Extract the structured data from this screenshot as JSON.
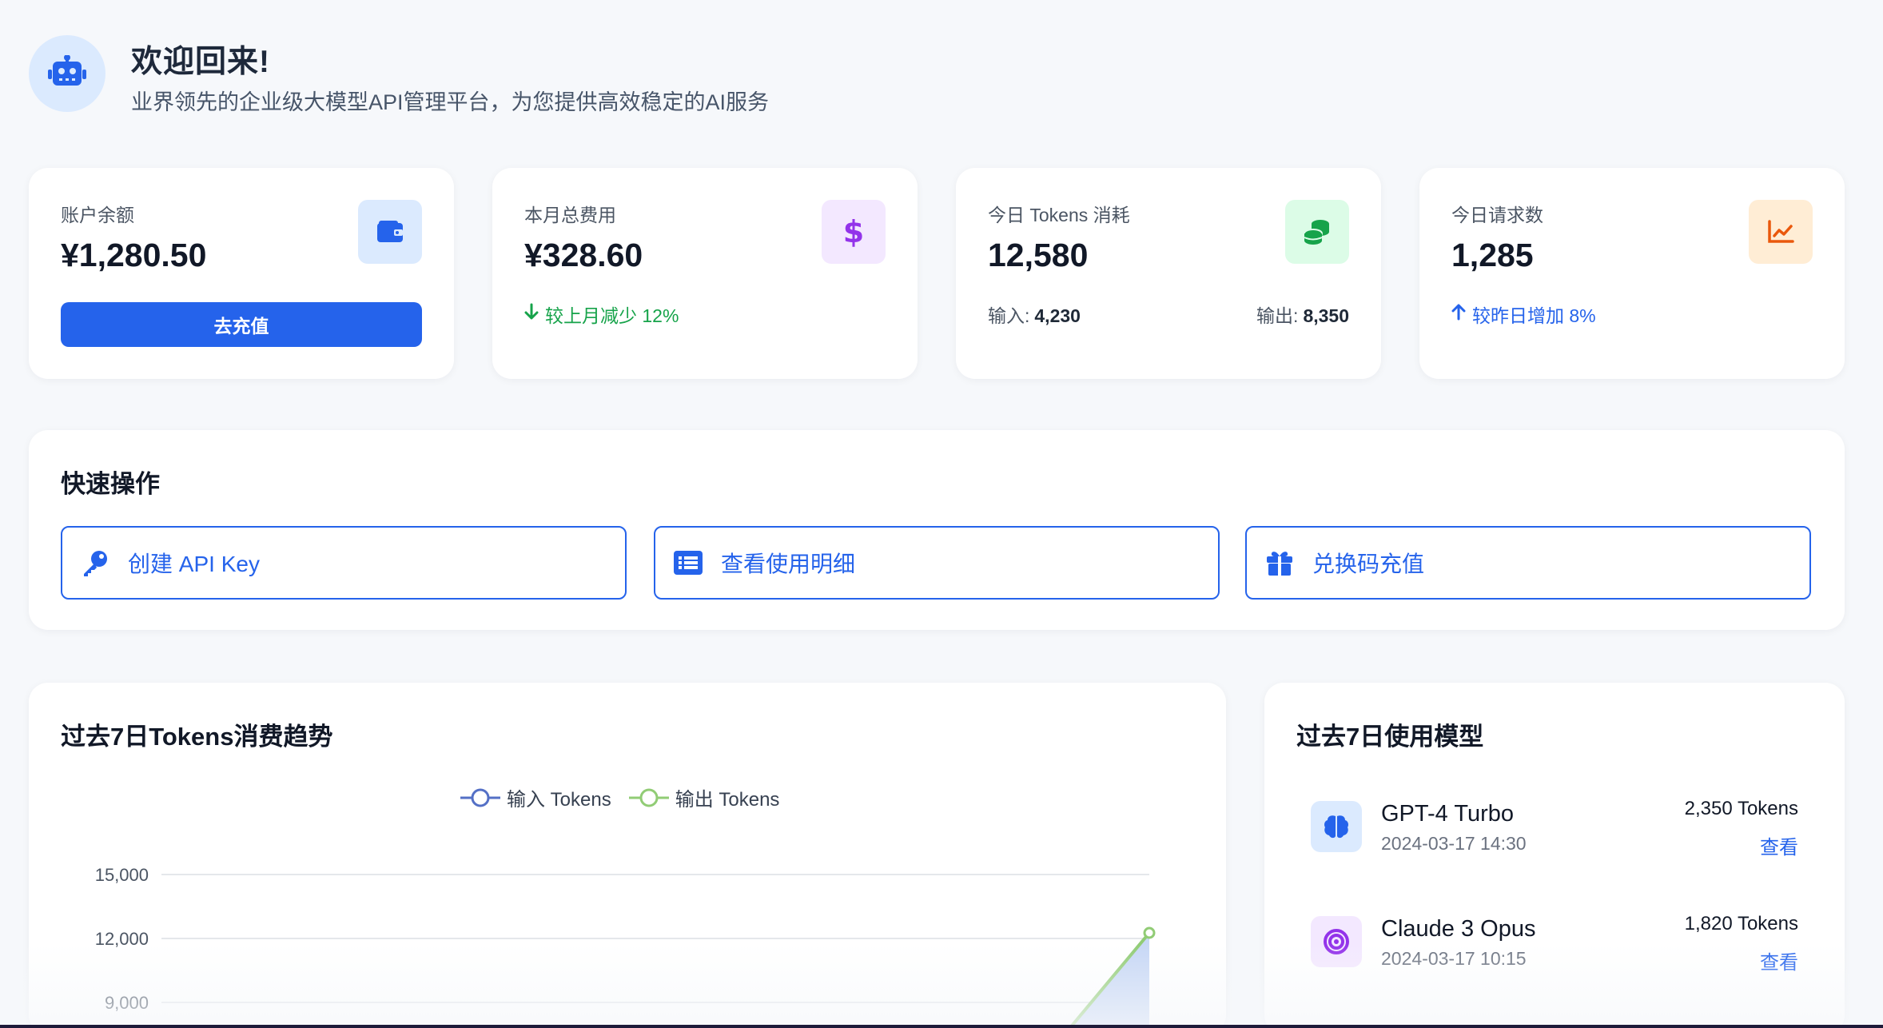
{
  "header": {
    "title": "欢迎回来!",
    "subtitle": "业界领先的企业级大模型API管理平台，为您提供高效稳定的AI服务",
    "avatar_icon": "robot-icon"
  },
  "stats": {
    "balance": {
      "label": "账户余额",
      "value": "¥1,280.50",
      "button": "去充值",
      "icon": "wallet-icon",
      "color": "#2563eb"
    },
    "monthly_cost": {
      "label": "本月总费用",
      "value": "¥328.60",
      "trend": "较上月减少 12%",
      "trend_dir": "down",
      "icon": "dollar-icon",
      "color": "#9333ea"
    },
    "tokens_today": {
      "label": "今日 Tokens 消耗",
      "value": "12,580",
      "input_label": "输入:",
      "input_value": "4,230",
      "output_label": "输出:",
      "output_value": "8,350",
      "icon": "coins-icon",
      "color": "#16a34a"
    },
    "requests_today": {
      "label": "今日请求数",
      "value": "1,285",
      "trend": "较昨日增加 8%",
      "trend_dir": "up",
      "icon": "chart-line-icon",
      "color": "#ea580c"
    }
  },
  "quick_actions": {
    "title": "快速操作",
    "items": [
      {
        "label": "创建 API Key",
        "icon": "key-icon"
      },
      {
        "label": "查看使用明细",
        "icon": "list-icon"
      },
      {
        "label": "兑换码充值",
        "icon": "gift-icon"
      }
    ]
  },
  "trend_chart": {
    "title": "过去7日Tokens消费趋势",
    "legend": [
      "输入 Tokens",
      "输出 Tokens"
    ]
  },
  "chart_data": {
    "type": "line",
    "title": "过去7日Tokens消费趋势",
    "y_ticks": [
      "15,000",
      "12,000",
      "9,000"
    ],
    "ylim": [
      0,
      15000
    ],
    "grid": true,
    "legend_position": "top-center",
    "series": [
      {
        "name": "输入 Tokens",
        "color": "#5470c6"
      },
      {
        "name": "输出 Tokens",
        "color": "#91cc75",
        "last_value": 12600
      }
    ]
  },
  "models": {
    "title": "过去7日使用模型",
    "items": [
      {
        "name": "GPT-4 Turbo",
        "time": "2024-03-17 14:30",
        "tokens": "2,350 Tokens",
        "action": "查看",
        "icon": "brain-icon",
        "bg": "#dbeafe",
        "fg": "#2563eb"
      },
      {
        "name": "Claude 3 Opus",
        "time": "2024-03-17 10:15",
        "tokens": "1,820 Tokens",
        "action": "查看",
        "icon": "target-icon",
        "bg": "#f3e8ff",
        "fg": "#9333ea"
      }
    ]
  }
}
